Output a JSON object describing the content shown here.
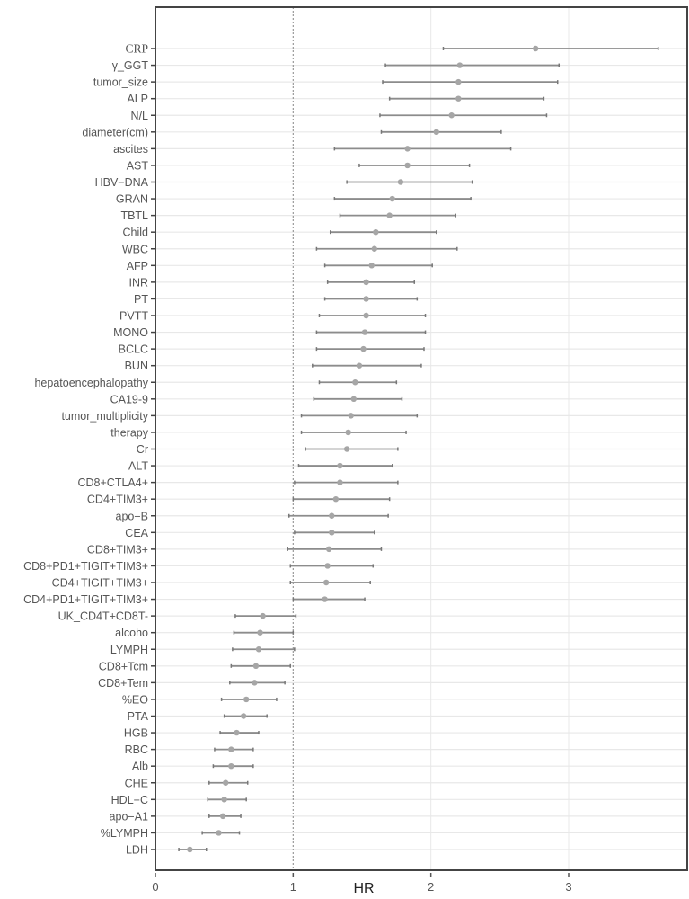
{
  "chart_data": {
    "type": "forest",
    "title": "",
    "xlabel": "HR",
    "ylabel": "",
    "xlim": [
      0,
      3.7
    ],
    "xticks": [
      0,
      1,
      2,
      3
    ],
    "xtick_labels": [
      "0",
      "1",
      "2",
      "3"
    ],
    "reference_line": 1,
    "grid": true,
    "legend": "none",
    "colors": {
      "point": "#a6a6a6",
      "whisker": "#8c8c8c",
      "frame": "#444444",
      "grid": "#e8e8e8",
      "reference": "#999999"
    },
    "rows": [
      {
        "label": "CRP",
        "hr": 2.76,
        "low": 2.09,
        "high": 3.65
      },
      {
        "label": "γ_GGT",
        "hr": 2.21,
        "low": 1.67,
        "high": 2.93
      },
      {
        "label": "tumor_size",
        "hr": 2.2,
        "low": 1.65,
        "high": 2.92
      },
      {
        "label": "ALP",
        "hr": 2.2,
        "low": 1.7,
        "high": 2.82
      },
      {
        "label": "N/L",
        "hr": 2.15,
        "low": 1.63,
        "high": 2.84
      },
      {
        "label": "diameter(cm)",
        "hr": 2.04,
        "low": 1.64,
        "high": 2.51
      },
      {
        "label": "ascites",
        "hr": 1.83,
        "low": 1.3,
        "high": 2.58
      },
      {
        "label": "AST",
        "hr": 1.83,
        "low": 1.48,
        "high": 2.28
      },
      {
        "label": "HBV−DNA",
        "hr": 1.78,
        "low": 1.39,
        "high": 2.3
      },
      {
        "label": "GRAN",
        "hr": 1.72,
        "low": 1.3,
        "high": 2.29
      },
      {
        "label": "TBTL",
        "hr": 1.7,
        "low": 1.34,
        "high": 2.18
      },
      {
        "label": "Child",
        "hr": 1.6,
        "low": 1.27,
        "high": 2.04
      },
      {
        "label": "WBC",
        "hr": 1.59,
        "low": 1.17,
        "high": 2.19
      },
      {
        "label": "AFP",
        "hr": 1.57,
        "low": 1.23,
        "high": 2.01
      },
      {
        "label": "INR",
        "hr": 1.53,
        "low": 1.25,
        "high": 1.88
      },
      {
        "label": "PT",
        "hr": 1.53,
        "low": 1.23,
        "high": 1.9
      },
      {
        "label": "PVTT",
        "hr": 1.53,
        "low": 1.19,
        "high": 1.96
      },
      {
        "label": "MONO",
        "hr": 1.52,
        "low": 1.17,
        "high": 1.96
      },
      {
        "label": "BCLC",
        "hr": 1.51,
        "low": 1.17,
        "high": 1.95
      },
      {
        "label": "BUN",
        "hr": 1.48,
        "low": 1.14,
        "high": 1.93
      },
      {
        "label": "hepatoencephalopathy",
        "hr": 1.45,
        "low": 1.19,
        "high": 1.75
      },
      {
        "label": "CA19-9",
        "hr": 1.44,
        "low": 1.15,
        "high": 1.79
      },
      {
        "label": "tumor_multiplicity",
        "hr": 1.42,
        "low": 1.06,
        "high": 1.9
      },
      {
        "label": "therapy",
        "hr": 1.4,
        "low": 1.06,
        "high": 1.82
      },
      {
        "label": "Cr",
        "hr": 1.39,
        "low": 1.09,
        "high": 1.76
      },
      {
        "label": "ALT",
        "hr": 1.34,
        "low": 1.04,
        "high": 1.72
      },
      {
        "label": "CD8+CTLA4+",
        "hr": 1.34,
        "low": 1.01,
        "high": 1.76
      },
      {
        "label": "CD4+TIM3+",
        "hr": 1.31,
        "low": 1.0,
        "high": 1.7
      },
      {
        "label": "apo−B",
        "hr": 1.28,
        "low": 0.97,
        "high": 1.69
      },
      {
        "label": "CEA",
        "hr": 1.28,
        "low": 1.01,
        "high": 1.59
      },
      {
        "label": "CD8+TIM3+",
        "hr": 1.26,
        "low": 0.96,
        "high": 1.64
      },
      {
        "label": "CD8+PD1+TIGIT+TIM3+",
        "hr": 1.25,
        "low": 0.98,
        "high": 1.58
      },
      {
        "label": "CD4+TIGIT+TIM3+",
        "hr": 1.24,
        "low": 0.98,
        "high": 1.56
      },
      {
        "label": "CD4+PD1+TIGIT+TIM3+",
        "hr": 1.23,
        "low": 1.0,
        "high": 1.52
      },
      {
        "label": "UK_CD4T+CD8T-",
        "hr": 0.78,
        "low": 0.58,
        "high": 1.02
      },
      {
        "label": "alcoho",
        "hr": 0.76,
        "low": 0.57,
        "high": 1.0
      },
      {
        "label": "LYMPH",
        "hr": 0.75,
        "low": 0.56,
        "high": 1.01
      },
      {
        "label": "CD8+Tcm",
        "hr": 0.73,
        "low": 0.55,
        "high": 0.98
      },
      {
        "label": "CD8+Tem",
        "hr": 0.72,
        "low": 0.54,
        "high": 0.94
      },
      {
        "label": "%EO",
        "hr": 0.66,
        "low": 0.48,
        "high": 0.88
      },
      {
        "label": "PTA",
        "hr": 0.64,
        "low": 0.5,
        "high": 0.81
      },
      {
        "label": "HGB",
        "hr": 0.59,
        "low": 0.47,
        "high": 0.75
      },
      {
        "label": "RBC",
        "hr": 0.55,
        "low": 0.43,
        "high": 0.71
      },
      {
        "label": "Alb",
        "hr": 0.55,
        "low": 0.42,
        "high": 0.71
      },
      {
        "label": "CHE",
        "hr": 0.51,
        "low": 0.39,
        "high": 0.67
      },
      {
        "label": "HDL−C",
        "hr": 0.5,
        "low": 0.38,
        "high": 0.66
      },
      {
        "label": "apo−A1",
        "hr": 0.49,
        "low": 0.39,
        "high": 0.62
      },
      {
        "label": "%LYMPH",
        "hr": 0.46,
        "low": 0.34,
        "high": 0.61
      },
      {
        "label": "LDH",
        "hr": 0.25,
        "low": 0.17,
        "high": 0.37
      }
    ]
  }
}
